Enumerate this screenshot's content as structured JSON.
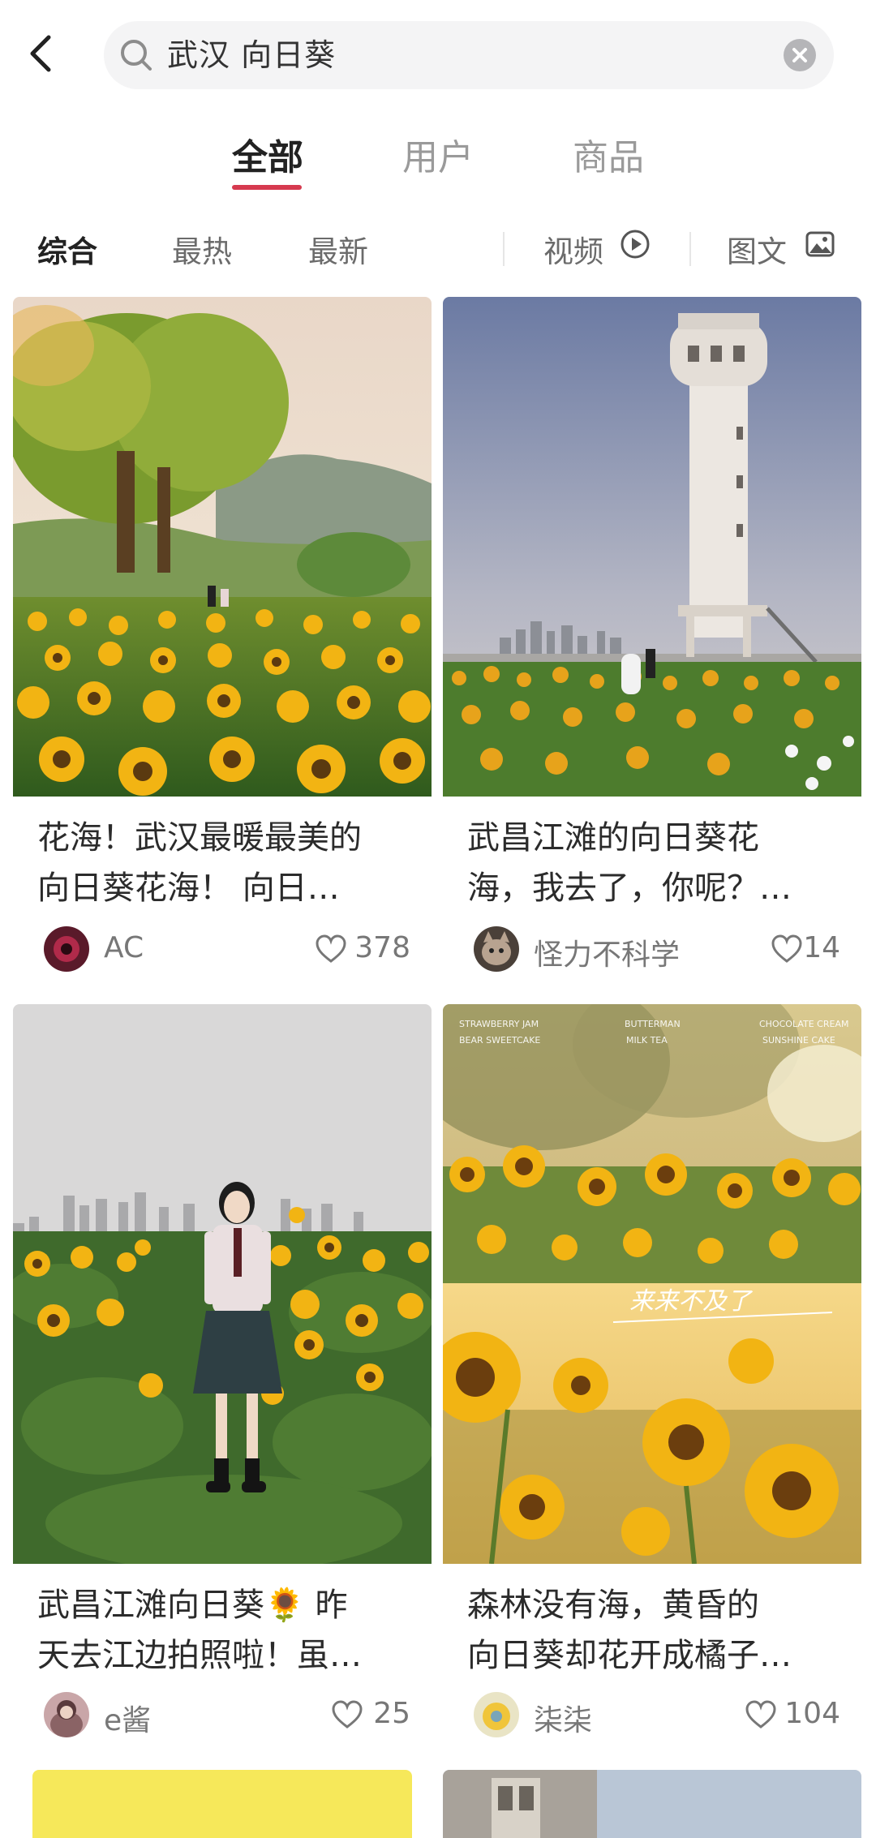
{
  "search": {
    "query": "武汉 向日葵"
  },
  "tabs": [
    {
      "label": "全部",
      "active": true
    },
    {
      "label": "用户",
      "active": false
    },
    {
      "label": "商品",
      "active": false
    }
  ],
  "filters": {
    "sort": [
      {
        "label": "综合",
        "active": true
      },
      {
        "label": "最热",
        "active": false
      },
      {
        "label": "最新",
        "active": false
      }
    ],
    "video_label": "视频",
    "image_label": "图文"
  },
  "posts": [
    {
      "title_line1": "花海！武汉最暖最美的",
      "title_line2": "向日葵花海！ 向日…",
      "author": "AC",
      "likes": "378"
    },
    {
      "title_line1": "武昌江滩的向日葵花",
      "title_line2": "海，我去了，你呢？…",
      "author": "怪力不科学",
      "likes": "14"
    },
    {
      "title_line1": "武昌江滩向日葵🌻 昨",
      "title_line2": "天去江边拍照啦！虽…",
      "author": "e酱",
      "likes": "25"
    },
    {
      "title_line1": "森林没有海，黄昏的",
      "title_line2": "向日葵却花开成橘子…",
      "author": "柒柒",
      "likes": "104"
    }
  ],
  "photo_text": {
    "left_top": "STRAWBERRY JAM",
    "left_bottom": "BEAR SWEETCAKE",
    "mid_top": "BUTTERMAN",
    "mid_bottom": "MILK TEA",
    "right_top": "CHOCOLATE CREAM",
    "right_bottom": "SUNSHINE CAKE",
    "script": "来来不及了"
  },
  "colors": {
    "accent": "#d63a4f",
    "sunflower": "#f2b413",
    "leaf": "#4f7a2a"
  }
}
